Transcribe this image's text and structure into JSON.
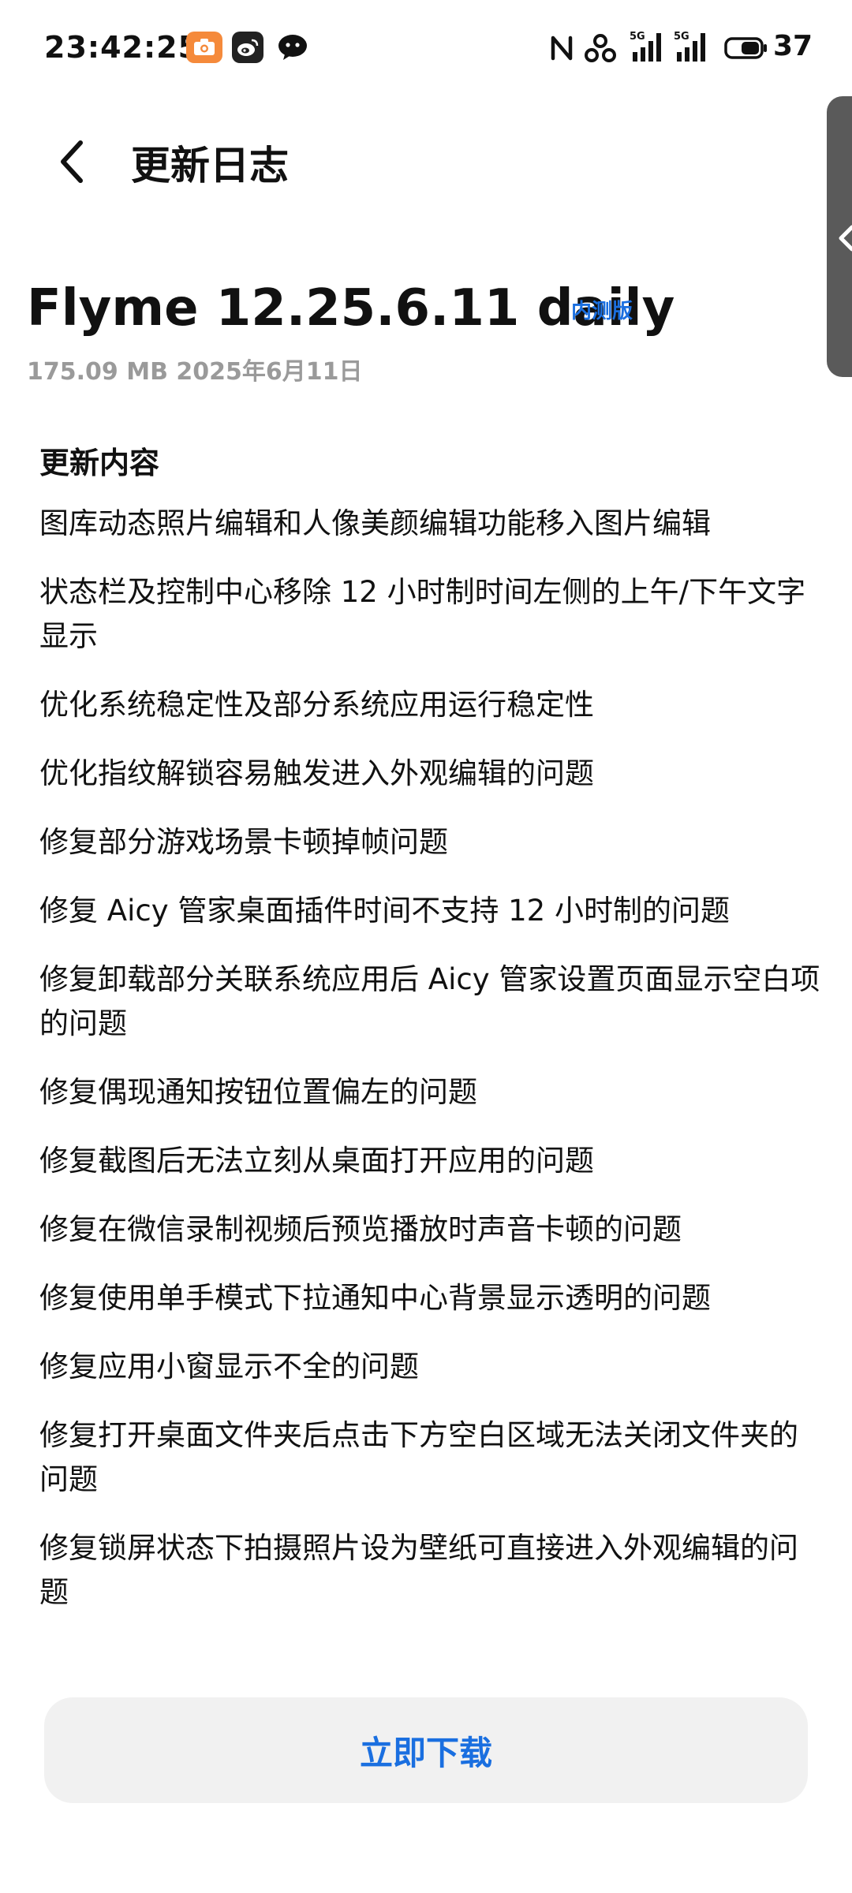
{
  "status_bar": {
    "time": "23:42:25",
    "notification_icons": [
      "camera-app-icon",
      "weibo-icon",
      "wechat-icon"
    ],
    "right_icons": [
      "nfc-icon",
      "hotspot-icon",
      "signal-5g-icon",
      "signal-5g-icon",
      "battery-icon"
    ],
    "signal_labels": [
      "5G",
      "5G"
    ],
    "battery_level": "37"
  },
  "header": {
    "title": "更新日志"
  },
  "version": {
    "name": "Flyme 12.25.6.11 daily",
    "badge": "内测版",
    "meta": "175.09 MB 2025年6月11日"
  },
  "changelog": {
    "heading": "更新内容",
    "items": [
      "图库动态照片编辑和人像美颜编辑功能移入图片编辑",
      "状态栏及控制中心移除 12 小时制时间左侧的上午/下午文字显示",
      "优化系统稳定性及部分系统应用运行稳定性",
      "优化指纹解锁容易触发进入外观编辑的问题",
      "修复部分游戏场景卡顿掉帧问题",
      "修复 Aicy 管家桌面插件时间不支持 12 小时制的问题",
      "修复卸载部分关联系统应用后 Aicy 管家设置页面显示空白项的问题",
      "修复偶现通知按钮位置偏左的问题",
      "修复截图后无法立刻从桌面打开应用的问题",
      "修复在微信录制视频后预览播放时声音卡顿的问题",
      "修复使用单手模式下拉通知中心背景显示透明的问题",
      "修复应用小窗显示不全的问题",
      "修复打开桌面文件夹后点击下方空白区域无法关闭文件夹的问题",
      "修复锁屏状态下拍摄照片设为壁纸可直接进入外观编辑的问题"
    ]
  },
  "actions": {
    "download_label": "立即下载"
  },
  "colors": {
    "accent": "#1a6fe0",
    "meta_text": "#9a9a9a",
    "button_bg": "#f1f1f1",
    "camera_icon": "#f58a3b"
  }
}
